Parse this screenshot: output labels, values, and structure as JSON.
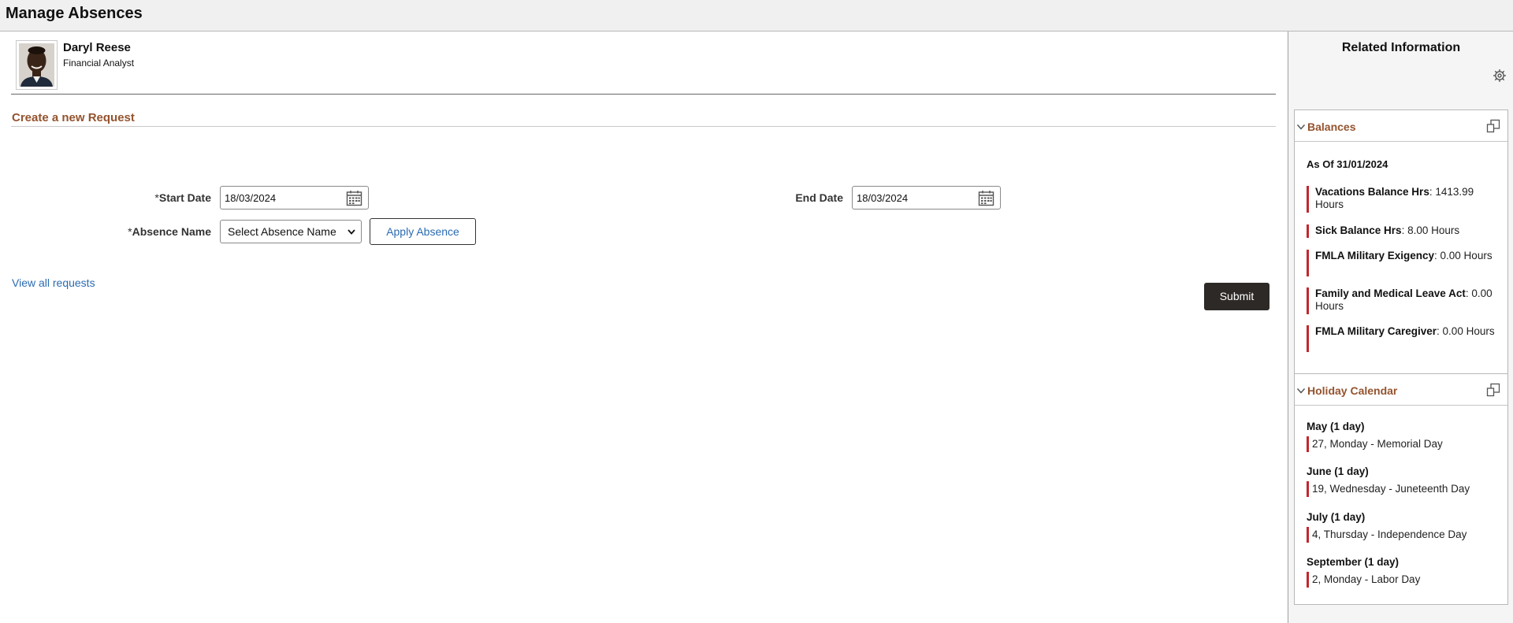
{
  "page": {
    "title": "Manage Absences"
  },
  "employee": {
    "name": "Daryl Reese",
    "role": "Financial Analyst"
  },
  "form": {
    "section_title": "Create a new Request",
    "start_date": {
      "required_mark": "*",
      "label": "Start Date",
      "value": "18/03/2024"
    },
    "end_date": {
      "label": "End Date",
      "value": "18/03/2024"
    },
    "absence_name": {
      "required_mark": "*",
      "label": "Absence Name",
      "value": "Select Absence Name"
    },
    "apply_label": "Apply Absence",
    "view_all_label": "View all requests",
    "submit_label": "Submit"
  },
  "related": {
    "title": "Related Information",
    "balances": {
      "title": "Balances",
      "as_of": "As Of 31/01/2024",
      "items": [
        {
          "name": "Vacations Balance Hrs",
          "value": ": 1413.99 Hours"
        },
        {
          "name": "Sick Balance Hrs",
          "value": ": 8.00 Hours"
        },
        {
          "name": "FMLA Military Exigency",
          "value": ": 0.00 Hours"
        },
        {
          "name": "Family and Medical Leave Act",
          "value": ": 0.00 Hours"
        },
        {
          "name": "FMLA Military Caregiver",
          "value": ": 0.00 Hours"
        }
      ]
    },
    "holiday_calendar": {
      "title": "Holiday Calendar",
      "months": [
        {
          "month": "May (1 day)",
          "holiday": "27, Monday - Memorial Day"
        },
        {
          "month": "June (1 day)",
          "holiday": "19, Wednesday - Juneteenth Day"
        },
        {
          "month": "July (1 day)",
          "holiday": "4, Thursday - Independence Day"
        },
        {
          "month": "September (1 day)",
          "holiday": "2, Monday - Labor Day"
        }
      ]
    }
  },
  "icons": {
    "calendar": "calendar-icon",
    "gear": "gear-icon",
    "collapse": "chevron-down-icon",
    "popout": "popout-icon"
  },
  "colors": {
    "section_title": "#94532e",
    "link": "#2a6bb1",
    "submit_bg": "#2d2927",
    "balance_bar": "#c1272d"
  }
}
